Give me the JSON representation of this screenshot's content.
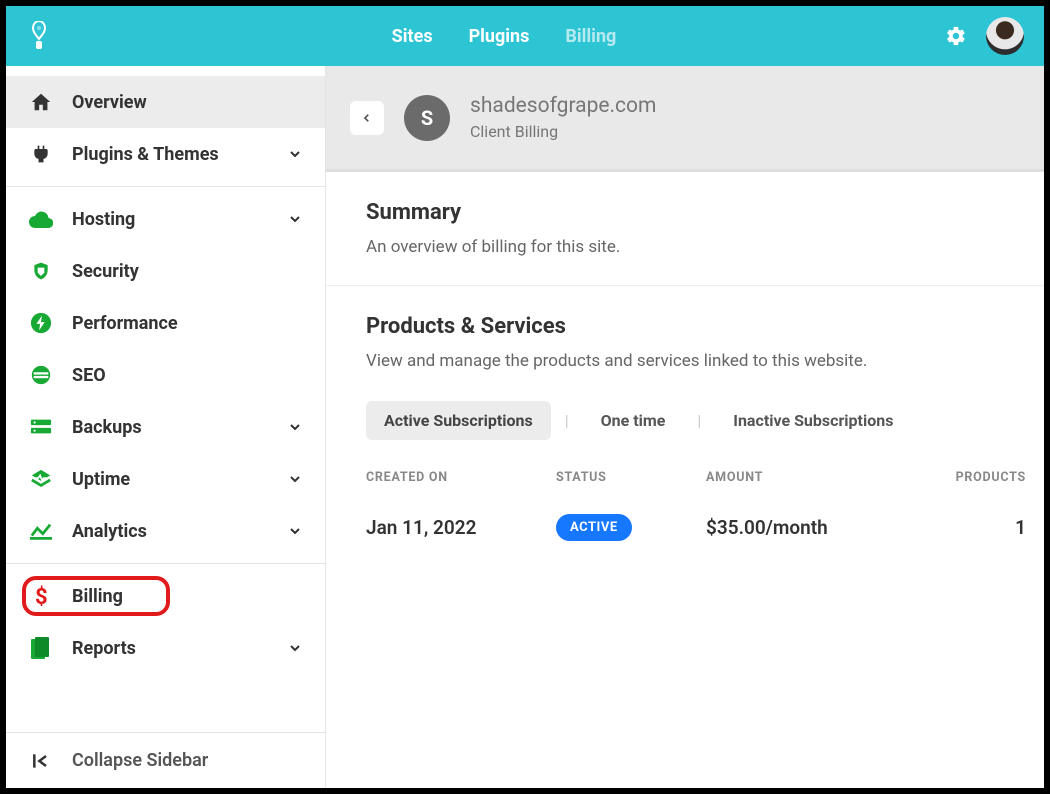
{
  "topnav": {
    "tabs": [
      {
        "label": "Sites",
        "active": true
      },
      {
        "label": "Plugins",
        "active": true
      },
      {
        "label": "Billing",
        "active": false
      }
    ]
  },
  "sidebar": {
    "overview": "Overview",
    "plugins_themes": "Plugins & Themes",
    "hosting": "Hosting",
    "security": "Security",
    "performance": "Performance",
    "seo": "SEO",
    "backups": "Backups",
    "uptime": "Uptime",
    "analytics": "Analytics",
    "billing": "Billing",
    "reports": "Reports",
    "collapse": "Collapse Sidebar"
  },
  "header": {
    "site_initial": "S",
    "site_name": "shadesofgrape.com",
    "subtitle": "Client Billing"
  },
  "summary": {
    "title": "Summary",
    "desc": "An overview of billing for this site."
  },
  "products": {
    "title": "Products & Services",
    "desc": "View and manage the products and services linked to this website.",
    "tabs": {
      "active": "Active Subscriptions",
      "onetime": "One time",
      "inactive": "Inactive Subscriptions"
    },
    "columns": {
      "created": "CREATED ON",
      "status": "STATUS",
      "amount": "AMOUNT",
      "products": "PRODUCTS"
    },
    "rows": [
      {
        "created": "Jan 11, 2022",
        "status": "ACTIVE",
        "amount": "$35.00/month",
        "products": "1"
      }
    ]
  }
}
